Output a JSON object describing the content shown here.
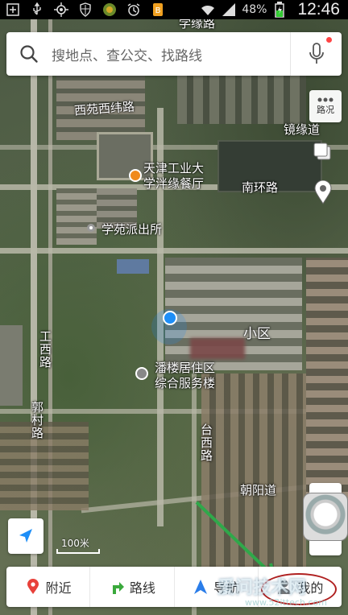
{
  "status_bar": {
    "battery_percent": "48%",
    "time": "12:46"
  },
  "search": {
    "placeholder": "搜地点、查公交、找路线"
  },
  "controls": {
    "traffic_label": "路况",
    "zoom_in": "+",
    "zoom_out": "−"
  },
  "map": {
    "labels": {
      "top_road": "学缘路",
      "xiyuan_west": "西苑西纬路",
      "jingyuan": "镜缘道",
      "tianjin_univ_1": "天津工业大",
      "tianjin_univ_2": "学泮缘餐厅",
      "nanhuan": "南环路",
      "police": "学苑派出所",
      "community_suffix": "小区",
      "gongxi": "工西路",
      "guocun": "郭村路",
      "panlou_1": "潘楼居住区",
      "panlou_2": "综合服务楼",
      "taixi": "台西路",
      "chaoyang": "朝阳道"
    },
    "scale_text": "100米"
  },
  "bottom_nav": {
    "items": [
      {
        "label": "附近"
      },
      {
        "label": "路线"
      },
      {
        "label": "导航"
      },
      {
        "label": "我的"
      }
    ]
  },
  "watermark": {
    "text": "爱问技术网",
    "url": "www.52ittech.com"
  },
  "colors": {
    "nav_red": "#e8413a",
    "nav_green": "#3aa93c",
    "nav_blue": "#2b7de9",
    "location_blue": "#1e8ef7"
  }
}
